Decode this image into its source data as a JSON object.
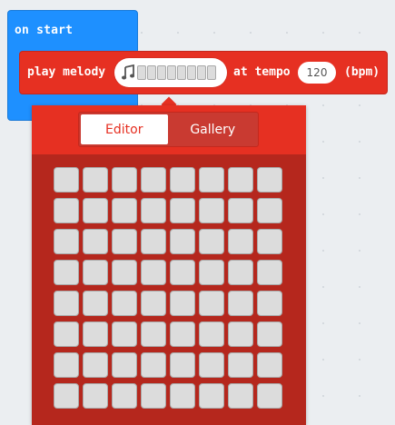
{
  "event_block": {
    "label": "on start",
    "color": "#1e90ff"
  },
  "music_block": {
    "prefix": "play melody",
    "middle": "at tempo",
    "tempo_value": "120",
    "unit": "(bpm)",
    "color": "#e63022",
    "melody_icon": "music-note-icon",
    "melody_cells": 8
  },
  "melody_editor": {
    "tabs": [
      {
        "label": "Editor",
        "active": true
      },
      {
        "label": "Gallery",
        "active": false
      }
    ],
    "grid_columns": 8,
    "grid_rows_visible": 8,
    "accent_color": "#e63022",
    "body_color": "#b5271d",
    "cell_color": "#dcdcdc"
  }
}
